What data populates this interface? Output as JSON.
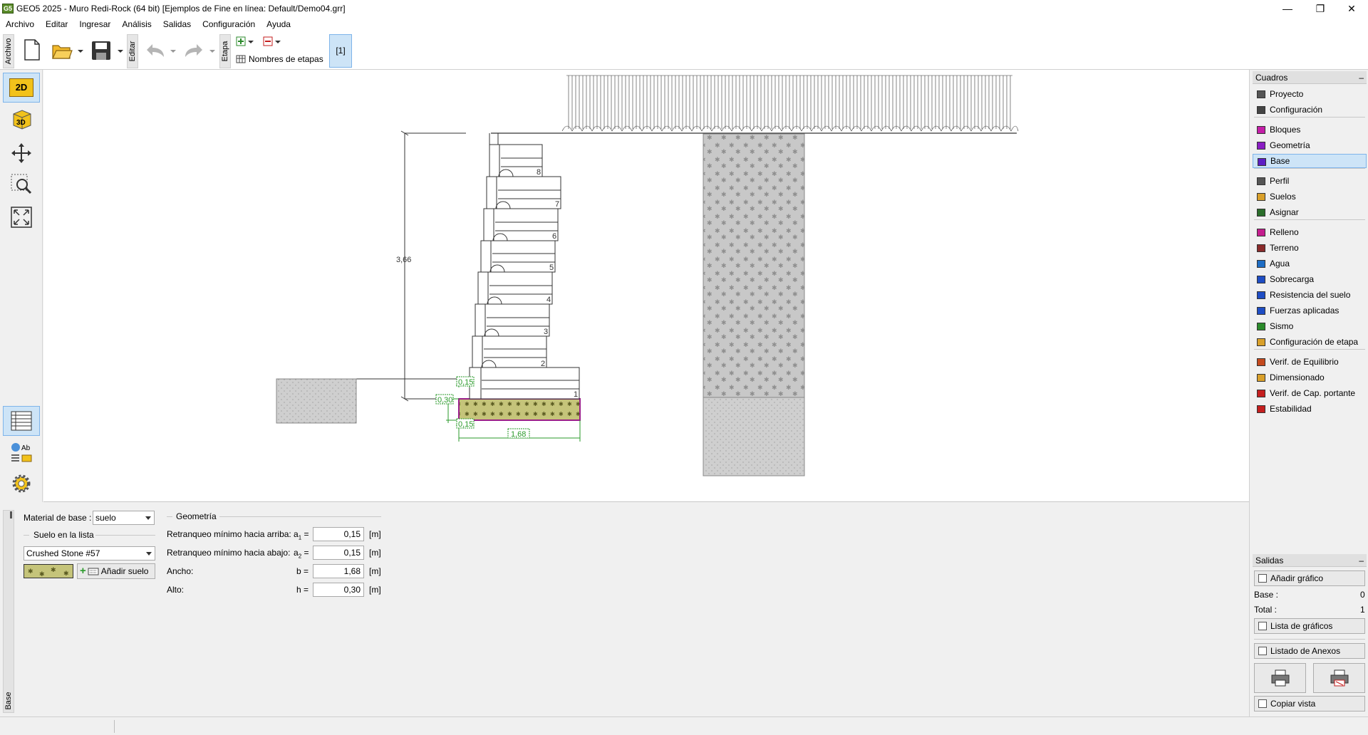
{
  "window": {
    "title": "GEO5 2025 - Muro Redi-Rock  (64 bit) [Ejemplos de Fine en línea: Default/Demo04.grr]",
    "app_icon": "G5",
    "minimize": "—",
    "restore": "❐",
    "close": "✕"
  },
  "menu": [
    "Archivo",
    "Editar",
    "Ingresar",
    "Análisis",
    "Salidas",
    "Configuración",
    "Ayuda"
  ],
  "toolbar": {
    "archivo_label": "Archivo",
    "editar_label": "Editar",
    "etapa_label": "Etapa",
    "stage_names_label": "Nombres de etapas",
    "stage_button": "[1]"
  },
  "left_toolbar": {
    "btn_2d": "2D",
    "btn_3d": "3D",
    "legend_ab": "Ab"
  },
  "drawing": {
    "height_dim": "3,66",
    "setback_top": "0,15",
    "base_height": "0,30",
    "setback_bottom": "0,15",
    "base_width": "1,68",
    "block_numbers": [
      "1",
      "2",
      "3",
      "4",
      "5",
      "6",
      "7",
      "8"
    ]
  },
  "bottom": {
    "side_label": "Base",
    "material_label": "Material de base :",
    "material_value": "suelo",
    "soil_list_label": "Suelo en la lista",
    "soil_value": "Crushed Stone #57",
    "add_soil_label": "Añadir suelo",
    "geometry_label": "Geometría",
    "rows": [
      {
        "label": "Retranqueo mínimo hacia arriba:",
        "symbol": "a",
        "sub": "1",
        "eq": " =",
        "value": "0,15",
        "unit": "[m]"
      },
      {
        "label": "Retranqueo mínimo hacia abajo:",
        "symbol": "a",
        "sub": "2",
        "eq": " =",
        "value": "0,15",
        "unit": "[m]"
      },
      {
        "label": "Ancho:",
        "symbol": "b",
        "sub": "",
        "eq": " =",
        "value": "1,68",
        "unit": "[m]"
      },
      {
        "label": "Alto:",
        "symbol": "h",
        "sub": "",
        "eq": " =",
        "value": "0,30",
        "unit": "[m]"
      }
    ]
  },
  "right_panel": {
    "cuadros_title": "Cuadros",
    "minimize": "–",
    "items": [
      {
        "label": "Proyecto",
        "icon": "document-icon",
        "color": "#555555"
      },
      {
        "label": "Configuración",
        "icon": "gear-icon",
        "color": "#444444"
      },
      {
        "label": "Bloques",
        "icon": "blocks-icon",
        "color": "#c41ea8"
      },
      {
        "label": "Geometría",
        "icon": "geometry-icon",
        "color": "#8a1ec4"
      },
      {
        "label": "Base",
        "icon": "base-icon",
        "color": "#5d1ec4"
      },
      {
        "label": "Perfil",
        "icon": "profile-icon",
        "color": "#555555"
      },
      {
        "label": "Suelos",
        "icon": "soils-icon",
        "color": "#d9a02a"
      },
      {
        "label": "Asignar",
        "icon": "assign-icon",
        "color": "#2a6d2a"
      },
      {
        "label": "Relleno",
        "icon": "backfill-icon",
        "color": "#c41e8e"
      },
      {
        "label": "Terreno",
        "icon": "terrain-icon",
        "color": "#8a2a2a"
      },
      {
        "label": "Agua",
        "icon": "water-icon",
        "color": "#1e6dc4"
      },
      {
        "label": "Sobrecarga",
        "icon": "surcharge-icon",
        "color": "#1e4dc4"
      },
      {
        "label": "Resistencia del suelo",
        "icon": "resistance-icon",
        "color": "#1e4dc4"
      },
      {
        "label": "Fuerzas aplicadas",
        "icon": "forces-icon",
        "color": "#1e4dc4"
      },
      {
        "label": "Sismo",
        "icon": "earthquake-icon",
        "color": "#2a8a2a"
      },
      {
        "label": "Configuración de etapa",
        "icon": "stage-settings-icon",
        "color": "#d9a02a"
      },
      {
        "label": "Verif. de Equilibrio",
        "icon": "equilibrium-icon",
        "color": "#c44a1e"
      },
      {
        "label": "Dimensionado",
        "icon": "dimensioning-icon",
        "color": "#d9a02a"
      },
      {
        "label": "Verif. de Cap. portante",
        "icon": "bearing-icon",
        "color": "#c41e1e"
      },
      {
        "label": "Estabilidad",
        "icon": "stability-icon",
        "color": "#c41e1e"
      }
    ],
    "salidas_title": "Salidas",
    "add_graphic": "Añadir gráfico",
    "base_count_label": "Base :",
    "base_count": "0",
    "total_label": "Total :",
    "total_count": "1",
    "graphics_list": "Lista de gráficos",
    "annex_list": "Listado de Anexos",
    "copy_view": "Copiar vista"
  }
}
